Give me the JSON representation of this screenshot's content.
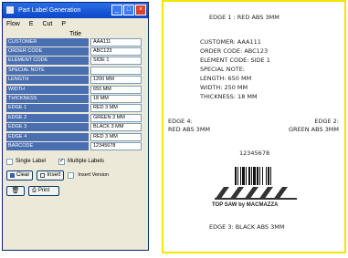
{
  "window": {
    "title": "Part Label Generation",
    "menu": [
      "Flow",
      "E",
      "Cut",
      "P"
    ],
    "form_title": "Title",
    "fields": [
      {
        "label": "CUSTOMER",
        "value": "AAA111"
      },
      {
        "label": "ORDER CODE",
        "value": "ABC123"
      },
      {
        "label": "ELEMENT CODE",
        "value": "SIDE 1"
      },
      {
        "label": "SPECIAL NOTE",
        "value": ""
      },
      {
        "label": "LENGTH",
        "value": "1200 MM"
      },
      {
        "label": "WIDTH",
        "value": "650 MM"
      },
      {
        "label": "THICKNESS",
        "value": "18 MM"
      },
      {
        "label": "EDGE 1",
        "value": "RED 3 MM"
      },
      {
        "label": "EDGE 2",
        "value": "GREEN 3 MM"
      },
      {
        "label": "EDGE 3",
        "value": "BLACK 3 MM"
      },
      {
        "label": "EDGE 4",
        "value": "RED 3 MM"
      },
      {
        "label": "BARCODE",
        "value": "12345678"
      }
    ],
    "single_label": "Single Label",
    "multiple_labels": "Multiple Labels",
    "multiple_checked": true,
    "btn_clear": "Clear",
    "btn_insert": "Insert",
    "insert_version": "Insert Version",
    "btn_print": "Print"
  },
  "label": {
    "edge1": "EDGE 1 : RED ABS 3MM",
    "customer": "CUSTOMER: AAA111",
    "order_code": "ORDER CODE: ABC123",
    "element_code": "ELEMENT CODE: SIDE 1",
    "special_note": "SPECIAL NOTE:",
    "length": "LENGTH: 650 MM",
    "width": "WIDTH: 250 MM",
    "thickness": "THICKNESS: 18 MM",
    "edge4_title": "EDGE 4:",
    "edge4_value": "RED ABS 3MM",
    "edge2_title": "EDGE 2:",
    "edge2_value": "GREEN ABS 3MM",
    "barcode_number": "12345678",
    "brand": "TOP SAW by MACMAZZA",
    "edge3": "EDGE 3: BLACK ABS 3MM",
    "border_color": "#f5e600"
  }
}
